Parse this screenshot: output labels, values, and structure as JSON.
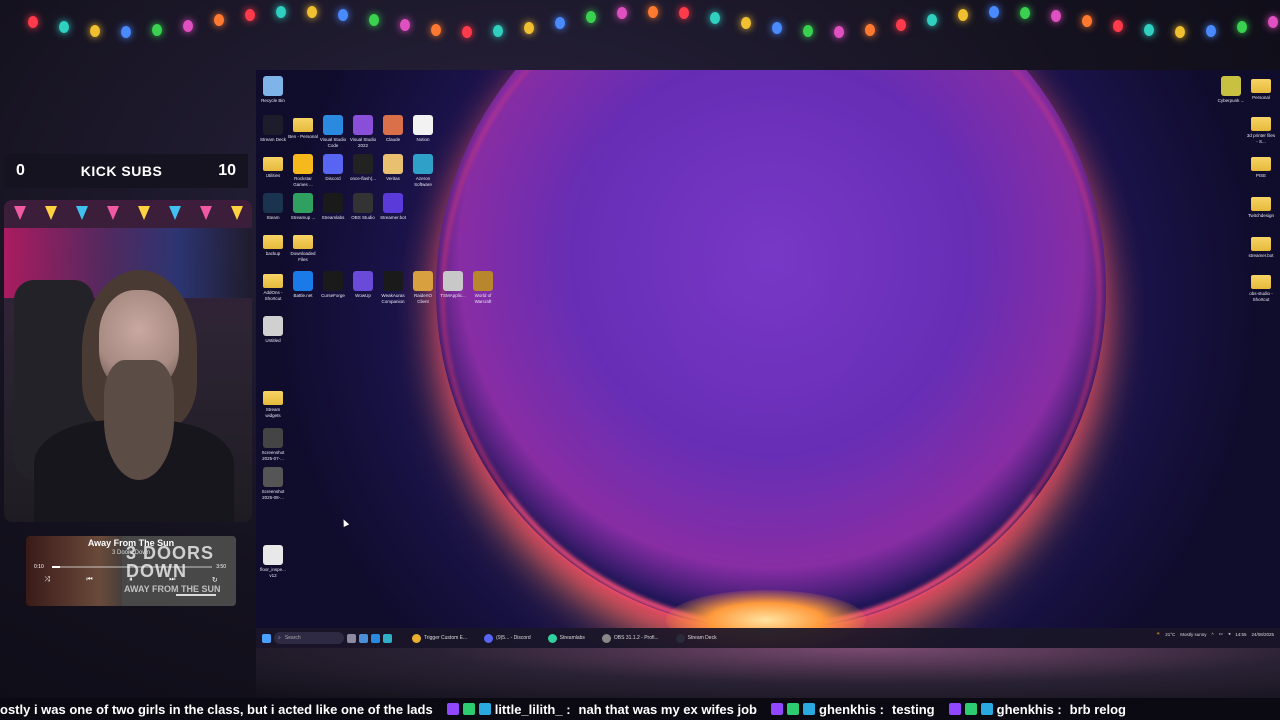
{
  "subs_widget": {
    "current": "0",
    "label": "KICK SUBS",
    "goal": "10"
  },
  "desktop_icons_left": [
    {
      "label": "Recycle Bin",
      "icon": "recycle-bin-icon",
      "color": "#7fb4e8"
    },
    {
      "label": "Stream Deck",
      "icon": "stream-deck-icon",
      "color": "#1c1c2a"
    },
    {
      "label": "Ben - Personal",
      "icon": "folder-app-icon",
      "color": "#3aa0e6"
    },
    {
      "label": "Visual Studio Code",
      "icon": "vscode-icon",
      "color": "#2a8ae0"
    },
    {
      "label": "Visual Studio 2022",
      "icon": "visual-studio-icon",
      "color": "#8a4fd8"
    },
    {
      "label": "Claude",
      "icon": "claude-icon",
      "color": "#d9704a"
    },
    {
      "label": "Notion",
      "icon": "notion-icon",
      "color": "#f2f2f2"
    },
    {
      "label": "Utilities",
      "icon": "utilities-folder-icon",
      "color": "#f0c445"
    },
    {
      "label": "Rockstar Games ...",
      "icon": "rockstar-icon",
      "color": "#f6b81a"
    },
    {
      "label": "Discord",
      "icon": "discord-icon",
      "color": "#5865f2"
    },
    {
      "label": "once-flash(...",
      "icon": "once-flash-icon",
      "color": "#222"
    },
    {
      "label": "Veritas",
      "icon": "veritas-icon",
      "color": "#e8c070"
    },
    {
      "label": "Azeron Software",
      "icon": "azeron-icon",
      "color": "#2fa0c8"
    },
    {
      "label": "Steam",
      "icon": "steam-icon",
      "color": "#1a3450"
    },
    {
      "label": "Streamup ...",
      "icon": "streamup-icon",
      "color": "#30a060"
    },
    {
      "label": "Streamlabs",
      "icon": "streamlabs-icon",
      "color": "#1a1a1a"
    },
    {
      "label": "OBS Studio",
      "icon": "obs-icon",
      "color": "#333"
    },
    {
      "label": "Streamer.bot",
      "icon": "streamerbot-icon",
      "color": "#5a3ad8"
    },
    {
      "label": "backup",
      "icon": "backup-folder-icon",
      "color": "#f0c445"
    },
    {
      "label": "Downloaded Files",
      "icon": "downloads-folder-icon",
      "color": "#f0c445"
    },
    {
      "label": "AddOns - Shortcut",
      "icon": "addons-folder-icon",
      "color": "#f0c445"
    },
    {
      "label": "Battle.net",
      "icon": "battlenet-icon",
      "color": "#1a7ae8"
    },
    {
      "label": "CurseForge",
      "icon": "curseforge-icon",
      "color": "#1a1a1a"
    },
    {
      "label": "WowUp",
      "icon": "wowup-icon",
      "color": "#6a4ad8"
    },
    {
      "label": "WeakAuras Companion",
      "icon": "weakauras-icon",
      "color": "#1a1a1a"
    },
    {
      "label": "RaiderIO Client",
      "icon": "raiderio-icon",
      "color": "#d9a040"
    },
    {
      "label": "TSMApplic...",
      "icon": "tsm-icon",
      "color": "#c8c8c8"
    },
    {
      "label": "World of Warcraft",
      "icon": "wow-icon",
      "color": "#b8862c"
    },
    {
      "label": "Untitled",
      "icon": "untitled-icon",
      "color": "#d0d0d0"
    },
    {
      "label": "Stream widgets",
      "icon": "stream-widgets-folder-icon",
      "color": "#f0c445"
    },
    {
      "label": "Screenshot 2025-07-...",
      "icon": "screenshot-icon",
      "color": "#444"
    },
    {
      "label": "Screenshot 2025-08-...",
      "icon": "screenshot-icon",
      "color": "#555"
    },
    {
      "label": "floor_inspe... v12",
      "icon": "chrome-file-icon",
      "color": "#e8e8e8"
    }
  ],
  "desktop_icons_right": [
    {
      "label": "Cyberpunk ...",
      "icon": "cyberpunk-icon",
      "color": "#c8c040"
    },
    {
      "label": "Personal",
      "icon": "personal-folder-icon",
      "color": "#f0c445"
    },
    {
      "label": "3d printer files - S...",
      "icon": "printer-folder-icon",
      "color": "#f0c445"
    },
    {
      "label": "PISE",
      "icon": "pise-folder-icon",
      "color": "#f0c445"
    },
    {
      "label": "Twitchdesign",
      "icon": "twitchdesign-folder-icon",
      "color": "#f0c445"
    },
    {
      "label": "streamer.bot",
      "icon": "streamerbot-folder-icon",
      "color": "#f0c445"
    },
    {
      "label": "obs-studio - Shortcut",
      "icon": "obs-folder-icon",
      "color": "#f0c445"
    }
  ],
  "taskbar": {
    "search_placeholder": "Search",
    "apps": [
      {
        "label": "Trigger Custom E...",
        "icon": "chrome-icon"
      },
      {
        "label": "(9)5... - Discord",
        "icon": "discord-icon"
      },
      {
        "label": "Streamlabs",
        "icon": "streamlabs-icon"
      },
      {
        "label": "OBS 31.1.2 - Profi...",
        "icon": "obs-icon"
      },
      {
        "label": "Stream Deck",
        "icon": "stream-deck-icon"
      }
    ],
    "weather_temp": "21°C",
    "weather_desc": "Mostly sunny",
    "time": "14:55",
    "date": "24/08/2025"
  },
  "music": {
    "title": "Away From The Sun",
    "artist": "3 Doors Down",
    "elapsed": "0:10",
    "total": "3:50",
    "progress": 0.05,
    "art_text_line1": "3 DOORS",
    "art_text_line2": "DOWN",
    "art_subtitle": "AWAY FROM THE SUN"
  },
  "chat": [
    {
      "user": "",
      "text": "ostly i was one of two girls in the class, but i acted like one of the lads"
    },
    {
      "user": "little_lilith_",
      "text": "nah that was my ex wifes job"
    },
    {
      "user": "ghenkhis",
      "text": "testing"
    },
    {
      "user": "ghenkhis",
      "text": "brb relog"
    }
  ],
  "colors": {
    "accent_orb": "#6a2fb8",
    "orb_rim": "#ff4f7a",
    "chat_bg": "#0b0a12",
    "subs_bg": "#151320"
  }
}
